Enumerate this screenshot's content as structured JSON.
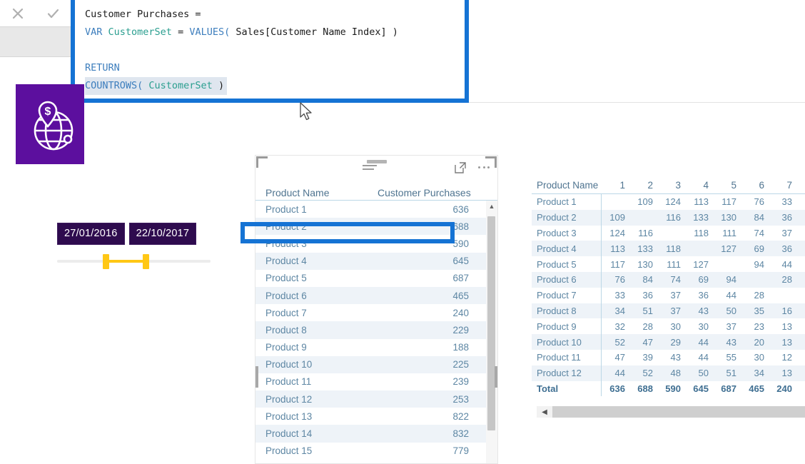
{
  "commit_bar": {
    "cancel_icon": "close-icon",
    "confirm_icon": "checkmark-icon"
  },
  "logo": {
    "name": "globe-money-pin-logo",
    "background": "#5C0F9E"
  },
  "formula": {
    "line1_plain": "Customer Purchases =",
    "line2_kw": "VAR",
    "line2_var": "CustomerSet",
    "line2_eq": " = ",
    "line2_fn": "VALUES(",
    "line2_arg": " Sales[Customer Name Index] )",
    "line4_return": "RETURN",
    "line5_fn": "COUNTROWS(",
    "line5_var": " CustomerSet",
    "line5_close": " )",
    "accent_border": "#1573D4",
    "keyword_color": "#3D7EBD",
    "variable_color": "#2A9E8F"
  },
  "slicer": {
    "start_date": "27/01/2016",
    "end_date": "22/10/2017",
    "pill_background": "#2E0B4E",
    "handle_color": "#FFC715"
  },
  "table_visual": {
    "filter_icon": "filter-icon",
    "focus_icon": "focus-mode-icon",
    "more_icon": "more-options-icon",
    "scroll_up_icon": "chevron-up-icon",
    "columns": [
      "Product Name",
      "Customer Purchases"
    ],
    "rows": [
      {
        "name": "Product 1",
        "value": "636"
      },
      {
        "name": "Product 2",
        "value": "688"
      },
      {
        "name": "Product 3",
        "value": "590"
      },
      {
        "name": "Product 4",
        "value": "645"
      },
      {
        "name": "Product 5",
        "value": "687"
      },
      {
        "name": "Product 6",
        "value": "465"
      },
      {
        "name": "Product 7",
        "value": "240"
      },
      {
        "name": "Product 8",
        "value": "229"
      },
      {
        "name": "Product 9",
        "value": "188"
      },
      {
        "name": "Product 10",
        "value": "225"
      },
      {
        "name": "Product 11",
        "value": "239"
      },
      {
        "name": "Product 12",
        "value": "253"
      },
      {
        "name": "Product 13",
        "value": "822"
      },
      {
        "name": "Product 14",
        "value": "832"
      },
      {
        "name": "Product 15",
        "value": "779"
      }
    ],
    "highlighted_row": "Product 2",
    "highlight_color": "#1573D4"
  },
  "matrix_visual": {
    "row_header": "Product Name",
    "column_headers": [
      "1",
      "2",
      "3",
      "4",
      "5",
      "6",
      "7"
    ],
    "scroll_left_icon": "chevron-left-icon",
    "rows": [
      {
        "name": "Product 1",
        "values": [
          "",
          "109",
          "124",
          "113",
          "117",
          "76",
          "33"
        ]
      },
      {
        "name": "Product 2",
        "values": [
          "109",
          "",
          "116",
          "133",
          "130",
          "84",
          "36"
        ]
      },
      {
        "name": "Product 3",
        "values": [
          "124",
          "116",
          "",
          "118",
          "111",
          "74",
          "37"
        ]
      },
      {
        "name": "Product 4",
        "values": [
          "113",
          "133",
          "118",
          "",
          "127",
          "69",
          "36"
        ]
      },
      {
        "name": "Product 5",
        "values": [
          "117",
          "130",
          "111",
          "127",
          "",
          "94",
          "44"
        ]
      },
      {
        "name": "Product 6",
        "values": [
          "76",
          "84",
          "74",
          "69",
          "94",
          "",
          "28"
        ]
      },
      {
        "name": "Product 7",
        "values": [
          "33",
          "36",
          "37",
          "36",
          "44",
          "28",
          ""
        ]
      },
      {
        "name": "Product 8",
        "values": [
          "34",
          "51",
          "37",
          "43",
          "50",
          "35",
          "16"
        ]
      },
      {
        "name": "Product 9",
        "values": [
          "32",
          "28",
          "30",
          "30",
          "37",
          "23",
          "13"
        ]
      },
      {
        "name": "Product 10",
        "values": [
          "52",
          "47",
          "29",
          "44",
          "43",
          "20",
          "13"
        ]
      },
      {
        "name": "Product 11",
        "values": [
          "47",
          "39",
          "43",
          "44",
          "55",
          "30",
          "12"
        ]
      },
      {
        "name": "Product 12",
        "values": [
          "44",
          "52",
          "48",
          "50",
          "51",
          "34",
          "13"
        ]
      }
    ],
    "total_row": {
      "name": "Total",
      "values": [
        "636",
        "688",
        "590",
        "645",
        "687",
        "465",
        "240"
      ]
    }
  },
  "cursor": {
    "name": "mouse-pointer"
  }
}
